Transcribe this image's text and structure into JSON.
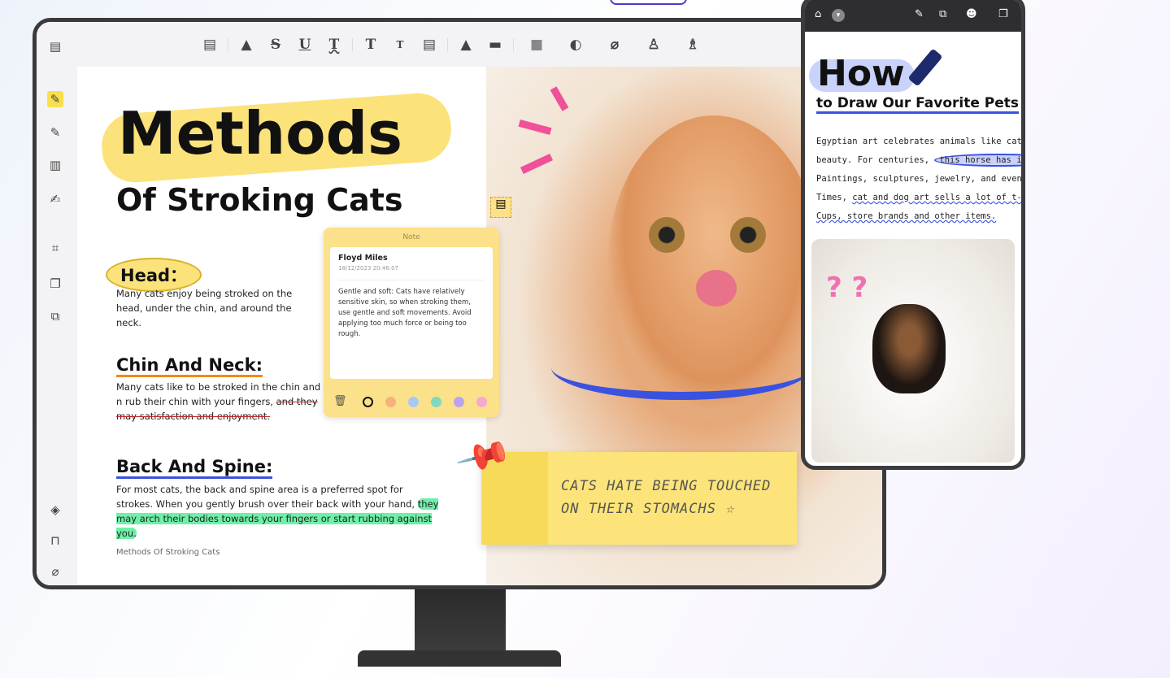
{
  "toolbar": {
    "icons": [
      "comment-icon",
      "highlight-icon",
      "strikethrough-icon",
      "underline-icon",
      "squiggly-icon",
      "text-icon",
      "textbox-icon",
      "text-callout-icon",
      "pencil-icon",
      "eraser-icon",
      "shape-icon",
      "area-icon",
      "attachment-icon",
      "stamp-icon",
      "signature-icon"
    ],
    "glyphs": [
      "▤",
      "▲",
      "S",
      "U",
      "T",
      "T",
      "T",
      "▤",
      "▲",
      "▬",
      "■",
      "◐",
      "⌀",
      "♙",
      "♗"
    ]
  },
  "sidebar": {
    "top": [
      "thumbnail-icon",
      "highlight-tool-icon",
      "edit-icon",
      "organize-icon",
      "sign-icon",
      "crop-icon",
      "pages-icon",
      "compress-icon"
    ],
    "bottom": [
      "layers-icon",
      "bookmark-icon",
      "attachment-icon"
    ]
  },
  "document": {
    "title": "Methods",
    "subtitle": "Of Stroking Cats",
    "sections": [
      {
        "heading": "Head：",
        "text": "Many cats enjoy being stroked on the head, under the chin, and around the neck."
      },
      {
        "heading": "Chin And Neck:",
        "text": "Many cats like to be stroked in the chin and n rub their chin with your fingers,",
        "struck": "and they may satisfaction and enjoyment."
      },
      {
        "heading": "Back And Spine:",
        "text": "For most cats, the back and spine area is a preferred spot for strokes. When you gently brush over their back with your hand,",
        "highlight": "they may arch their bodies towards your fingers or start rubbing against you."
      }
    ],
    "footer": "Methods Of Stroking Cats"
  },
  "note": {
    "title": "Note",
    "author": "Floyd Miles",
    "timestamp": "18/12/2023 20:46:07",
    "text": "Gentle and soft: Cats have relatively sensitive skin, so when stroking them, use gentle and soft movements. Avoid applying too much force or being too rough.",
    "colors": [
      "#fbe189",
      "#f6b27a",
      "#a9c8f5",
      "#7fd9bd",
      "#b9a3ef",
      "#f5a9cf"
    ]
  },
  "sticky": {
    "text_line1": "CATS HATE BEING TOUCHED",
    "text_line2": "ON THEIR STOMACHS ☆"
  },
  "tablet": {
    "title": "How",
    "subtitle": "to Draw Our Favorite Pets",
    "lines": [
      "Egyptian art celebrates animals like cats with st",
      "beauty. For centuries,",
      "this horse has inspired",
      "Paintings, sculptures, jewelry, and even armor. I",
      "Times,",
      "cat and dog art sells a lot of t-shirts, cale",
      "Cups, store brands and other items."
    ],
    "question_marks": "? ?"
  },
  "colors": {
    "highlight_yellow": "#fbe27a",
    "accent_blue": "#3a52e0",
    "highlight_green": "#6ef0a8",
    "orange": "#f08a1c"
  }
}
